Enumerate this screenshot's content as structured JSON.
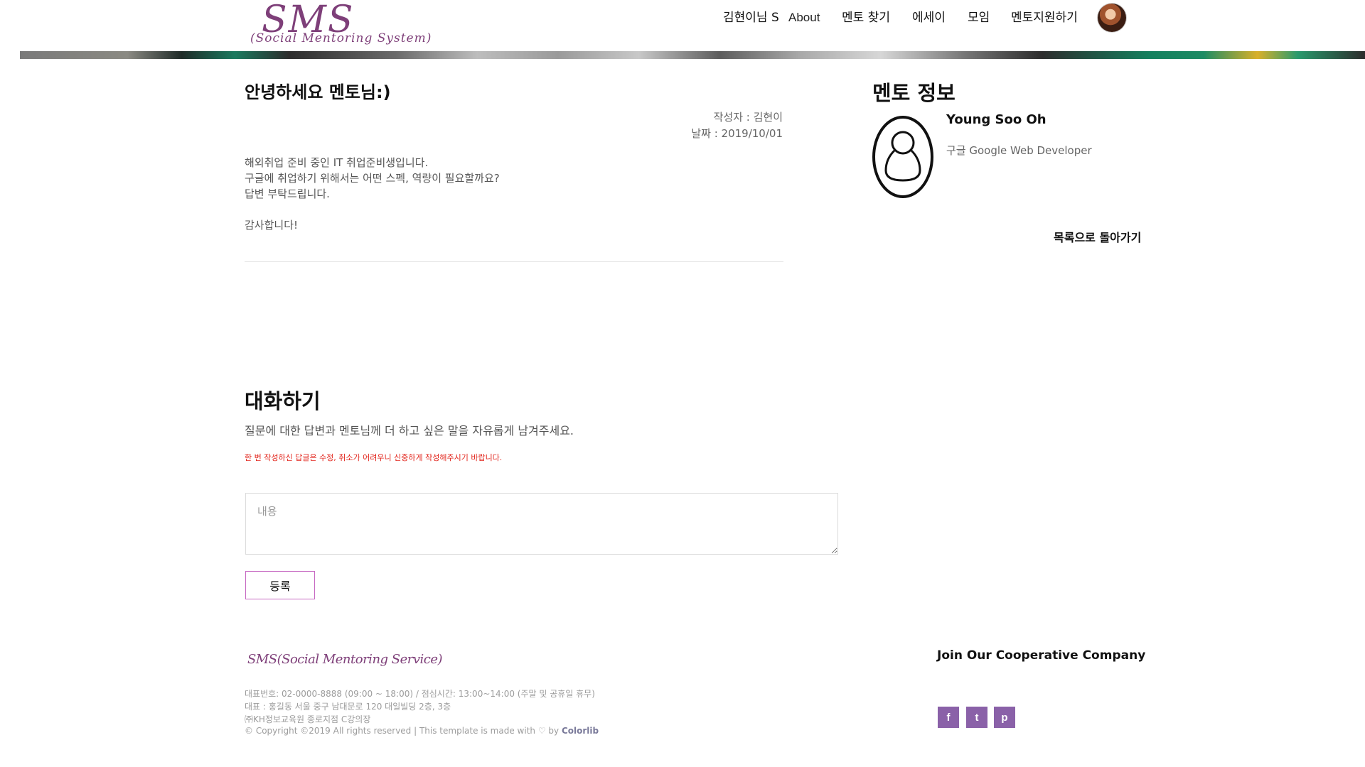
{
  "header": {
    "logo_main": "SMS",
    "logo_sub": "(Social Mentoring System)",
    "nav": {
      "user": "김현이님 S",
      "about": "About",
      "find_mentor": "멘토 찾기",
      "essay": "에세이",
      "meeting": "모임",
      "apply_mentor": "멘토지원하기"
    }
  },
  "post": {
    "title": "안녕하세요 멘토님:)",
    "author": "작성자 : 김현이",
    "date": "날짜 : 2019/10/01",
    "body": [
      "해외취업 준비 중인 IT 취업준비생입니다.",
      "구글에 취업하기 위해서는 어떤 스펙, 역량이 필요할까요?",
      "답변 부탁드립니다.",
      "감사합니다!"
    ]
  },
  "mentor": {
    "section_title": "멘토 정보",
    "name": "Young Soo Oh",
    "role": "구글 Google Web Developer",
    "back_link": "목록으로 돌아가기"
  },
  "chat": {
    "title": "대화하기",
    "description": "질문에 대한 답변과 멘토님께 더 하고 싶은 말을 자유롭게 남겨주세요.",
    "warning": "한 번 작성하신 답글은 수정, 취소가 어려우니 신중하게 작성해주시기 바랍니다.",
    "input_placeholder": "내용",
    "submit_label": "등록"
  },
  "footer": {
    "logo": "SMS(Social Mentoring Service)",
    "lines": [
      "대표번호: 02-0000-8888 (09:00 ~ 18:00) / 점심시간: 13:00~14:00 (주말 및 공휴일 휴무)",
      "대표 : 홍길동 서울 중구 남대문로 120 대일빌딩 2층, 3층",
      "㈜KH정보교육원 종로지점 C강의장"
    ],
    "copyright_prefix": "© Copyright ©2019 All rights reserved | This template is made with ",
    "copyright_by": " by ",
    "copyright_link": "Colorlib",
    "join_title": "Join Our Cooperative Company",
    "social": {
      "facebook": "f",
      "twitter": "t",
      "pinterest": "p"
    }
  },
  "colors": {
    "brand": "#7e3f79",
    "button_border": "#c76ac3",
    "warning": "#e2231a",
    "social_bg": "#8a61a8"
  }
}
